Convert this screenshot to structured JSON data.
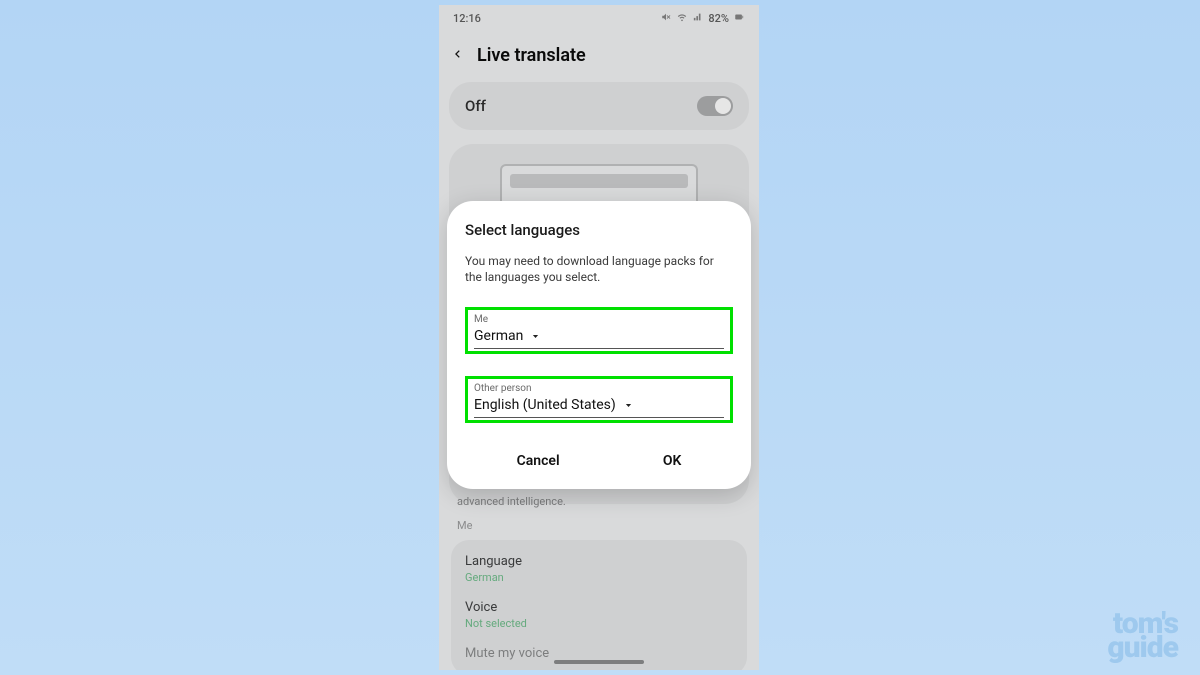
{
  "statusbar": {
    "time": "12:16",
    "battery": "82%"
  },
  "header": {
    "title": "Live translate"
  },
  "toggle": {
    "label": "Off",
    "enabled": false
  },
  "dialog": {
    "title": "Select languages",
    "description": "You may need to download language packs for the languages you select.",
    "fields": {
      "me": {
        "label": "Me",
        "value": "German"
      },
      "other": {
        "label": "Other person",
        "value": "English (United States)"
      }
    },
    "buttons": {
      "cancel": "Cancel",
      "ok": "OK"
    }
  },
  "below": {
    "description_tail": "advanced intelligence.",
    "section_label": "Me",
    "settings": [
      {
        "title": "Language",
        "value": "German"
      },
      {
        "title": "Voice",
        "value": "Not selected"
      },
      {
        "title": "Mute my voice",
        "value": ""
      }
    ]
  },
  "watermark": {
    "line1": "tom's",
    "line2": "guide"
  }
}
